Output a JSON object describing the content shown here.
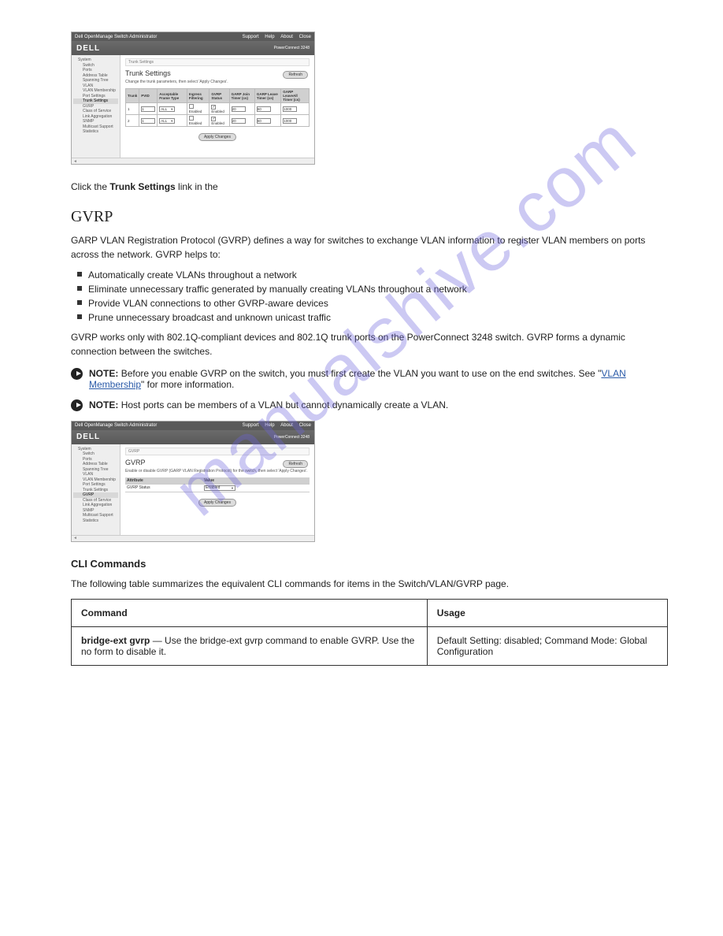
{
  "watermark": "manualshive.com",
  "screenshot1": {
    "topbar_left": "Dell OpenManage Switch Administrator",
    "topbar_right": [
      "Support",
      "Help",
      "About",
      "Close"
    ],
    "logo": "DELL",
    "product": "PowerConnect 3248",
    "breadcrumb": "Trunk Settings",
    "title": "Trunk Settings",
    "refresh": "Refresh",
    "desc": "Change the trunk parameters, then select 'Apply Changes'.",
    "sidebar": [
      "System",
      "Switch",
      "Ports",
      "Address Table",
      "Spanning Tree",
      "VLAN",
      "VLAN Membership",
      "Port Settings",
      "Trunk Settings",
      "GVRP",
      "Class of Service",
      "Link Aggregation",
      "SNMP",
      "Multicast Support",
      "Statistics"
    ],
    "headers": [
      "Trunk",
      "PVID",
      "Acceptable Frame Type",
      "Ingress Filtering",
      "GVRP Status",
      "GARP Join Timer (cs)",
      "GARP Leave Timer (cs)",
      "GARP LeaveAll Timer (cs)"
    ],
    "rows": [
      {
        "trunk": "1",
        "pvid": "1",
        "aft": "ALL",
        "ingress": false,
        "gvrp": true,
        "join": "20",
        "leave": "60",
        "leaveall": "1000"
      },
      {
        "trunk": "2",
        "pvid": "1",
        "aft": "ALL",
        "ingress": false,
        "gvrp": true,
        "join": "20",
        "leave": "60",
        "leaveall": "1000"
      }
    ],
    "apply": "Apply Changes"
  },
  "body1": {
    "line1_prefix": "Click the ",
    "line1_link": "Trunk Settings",
    "line1_suffix": " link in the "
  },
  "heading_gvrp": "GVRP",
  "gvrp_intro": "GARP VLAN Registration Protocol (GVRP) defines a way for switches to exchange VLAN information to register VLAN members on ports across the network. GVRP helps to:",
  "gvrp_bullets": [
    "Automatically create VLANs throughout a network",
    "Eliminate unnecessary traffic generated by manually creating VLANs throughout a network",
    "Provide VLAN connections to other GVRP-aware devices",
    "Prune unnecessary broadcast and unknown unicast traffic"
  ],
  "gvrp_para2": "GVRP works only with 802.1Q-compliant devices and 802.1Q trunk ports on the PowerConnect 3248 switch. GVRP forms a dynamic connection between the switches.",
  "note1": {
    "label": "NOTE:",
    "text_pre": "Before you enable GVRP on the switch, you must first create the VLAN you want to use on the end switches. See \"",
    "link": "VLAN Membership",
    "text_post": "\" for more information."
  },
  "note2": {
    "label": "NOTE:",
    "text": "Host ports can be members of a VLAN but cannot dynamically create a VLAN."
  },
  "screenshot2": {
    "topbar_left": "Dell OpenManage Switch Administrator",
    "topbar_right": [
      "Support",
      "Help",
      "About",
      "Close"
    ],
    "logo": "DELL",
    "product": "PowerConnect 3248",
    "breadcrumb": "GVRP",
    "title": "GVRP",
    "refresh": "Refresh",
    "desc": "Enable or disable GVRP (GARP VLAN Registration Protocol) for the switch, then select 'Apply Changes'.",
    "sidebar": [
      "System",
      "Switch",
      "Ports",
      "Address Table",
      "Spanning Tree",
      "VLAN",
      "VLAN Membership",
      "Port Settings",
      "Trunk Settings",
      "GVRP",
      "Class of Service",
      "Link Aggregation",
      "SNMP",
      "Multicast Support",
      "Statistics"
    ],
    "attr_header_left": "Attribute",
    "attr_header_right": "Value",
    "attr_name": "GVRP Status",
    "attr_value": "Enabled",
    "apply": "Apply Changes"
  },
  "subhead_cli": "CLI Commands",
  "cli_intro": "The following table summarizes the equivalent CLI commands for items in the Switch/VLAN/GVRP page.",
  "cli_table": {
    "headers": [
      "Command",
      "Usage"
    ],
    "row": {
      "cmd_prefix": "bridge-ext gvrp",
      "cmd_body": " — Use the bridge-ext gvrp command to enable GVRP. Use the no form to disable it.",
      "usage": "Default Setting: disabled; Command Mode: Global Configuration"
    }
  }
}
